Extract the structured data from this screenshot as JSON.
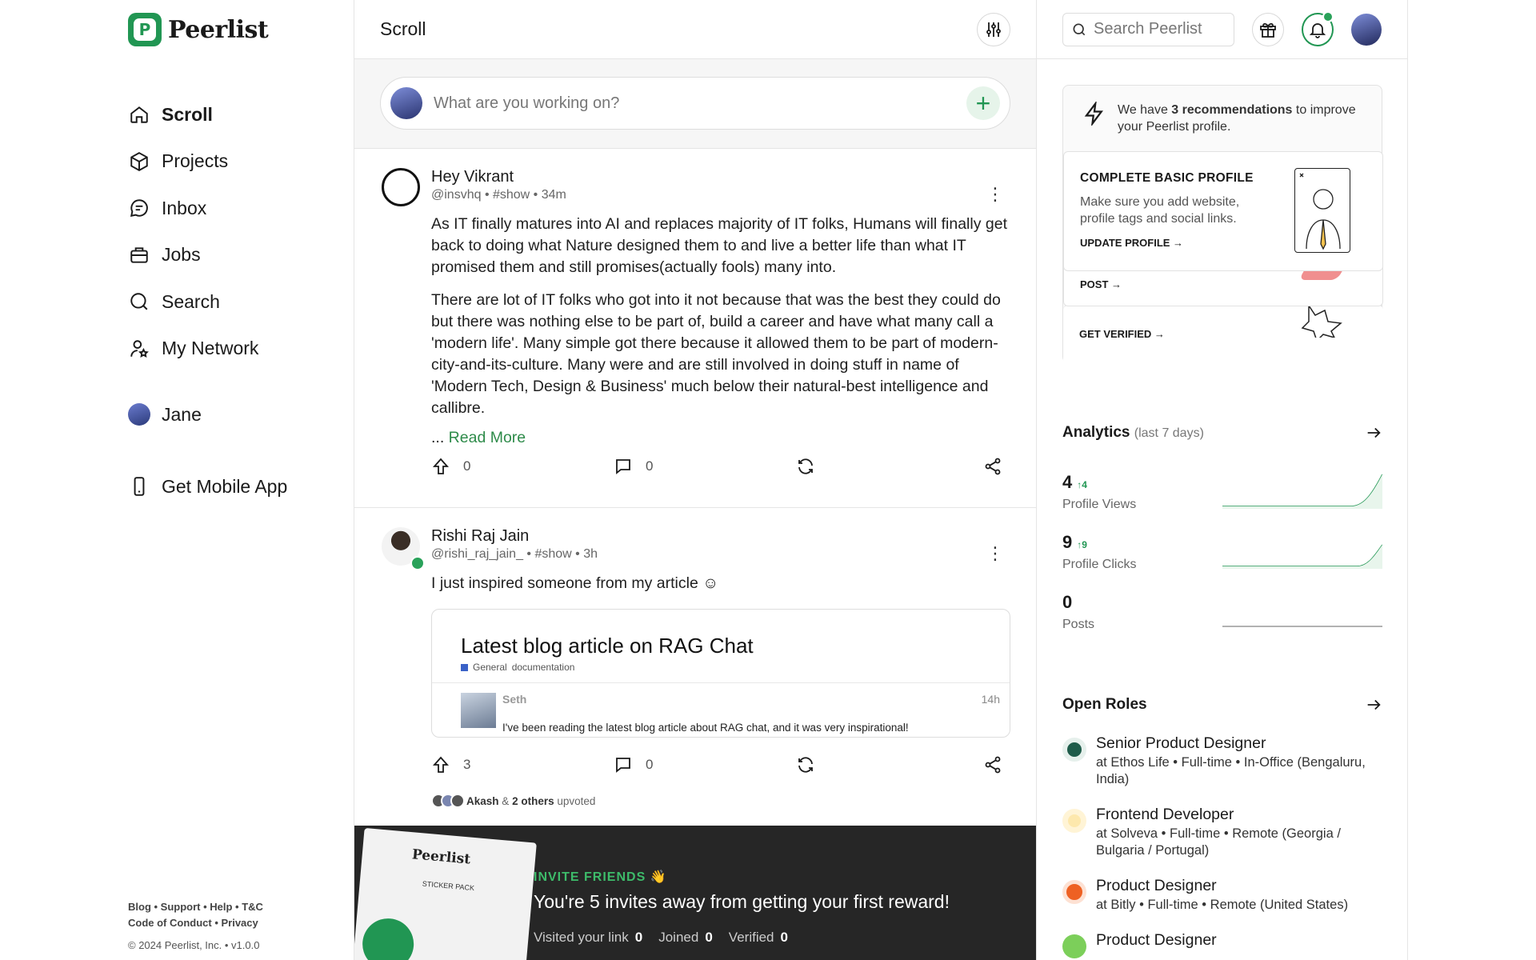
{
  "brand": {
    "name": "Peerlist",
    "mark": "P",
    "accent": "#219653"
  },
  "nav": {
    "items": [
      {
        "label": "Scroll",
        "icon": "home-icon",
        "active": true
      },
      {
        "label": "Projects",
        "icon": "cube-icon"
      },
      {
        "label": "Inbox",
        "icon": "chat-icon"
      },
      {
        "label": "Jobs",
        "icon": "briefcase-icon"
      },
      {
        "label": "Search",
        "icon": "search-icon"
      },
      {
        "label": "My Network",
        "icon": "network-icon"
      }
    ],
    "profile_name": "Jane",
    "mobile_label": "Get Mobile App"
  },
  "footer": {
    "links_line1": "Blog • Support • Help • T&C",
    "links_line2": "Code of Conduct • Privacy",
    "copyright": "© 2024 Peerlist, Inc. • v1.0.0"
  },
  "feed": {
    "title": "Scroll",
    "composer_placeholder": "What are you working on?",
    "posts": [
      {
        "author": "Hey Vikrant",
        "meta": "@insvhq • #show • 34m",
        "paragraphs": [
          "As IT finally matures into AI and replaces majority of IT folks, Humans will finally get back to doing what Nature designed them to and live a better life than what IT promised them and still promises(actually fools) many into.",
          "There are lot of IT folks who got into it not because that was the best they could do but there was nothing else to be part of, build a career and have what many call a 'modern life'. Many simple got there because it allowed them to be part of modern-city-and-its-culture. Many were and are still involved in doing stuff in name of 'Modern Tech, Design & Business' much below their natural-best intelligence and callibre."
        ],
        "read_more_prefix": "... ",
        "read_more": "Read More",
        "upvotes": "0",
        "comments": "0"
      },
      {
        "author": "Rishi Raj Jain",
        "meta": "@rishi_raj_jain_ • #show • 3h",
        "text": "I just inspired someone from my article ☺",
        "embed": {
          "title": "Latest blog article on RAG Chat",
          "tag1": "General",
          "tag2": "documentation",
          "author": "Seth",
          "time": "14h",
          "text": "I've been reading the latest blog article about RAG chat, and it was very inspirational!"
        },
        "upvotes": "3",
        "comments": "0",
        "upvoted_name": "Akash",
        "upvoted_others": "2 others",
        "upvoted_amp": "&",
        "upvoted_suffix": "upvoted"
      }
    ]
  },
  "invite": {
    "label": "INVITE FRIENDS 👋",
    "title": "You're 5 invites away from getting your first reward!",
    "visited_label": "Visited your link",
    "visited": "0",
    "joined_label": "Joined",
    "joined": "0",
    "verified_label": "Verified",
    "verified": "0",
    "sticker_title": "Peerlist",
    "sticker_sub": "STICKER PACK"
  },
  "right": {
    "search_placeholder": "Search Peerlist",
    "reco": {
      "prefix": "We have ",
      "bold": "3 recommendations",
      "suffix": " to improve your Peerlist profile.",
      "card_title": "COMPLETE BASIC PROFILE",
      "card_desc": "Make sure you add website, profile tags and social links.",
      "card_link": "UPDATE PROFILE →",
      "post_link": "POST →",
      "verify_link": "GET VERIFIED →"
    },
    "analytics": {
      "title": "Analytics",
      "subtitle": "(last 7 days)",
      "stats": [
        {
          "value": "4",
          "delta": "↑4",
          "label": "Profile Views"
        },
        {
          "value": "9",
          "delta": "↑9",
          "label": "Profile Clicks"
        },
        {
          "value": "0",
          "delta": "",
          "label": "Posts"
        }
      ]
    },
    "roles": {
      "title": "Open Roles",
      "items": [
        {
          "title": "Senior Product Designer",
          "sub": "at Ethos Life • Full-time • In-Office (Bengaluru, India)",
          "color": "#1f5c4a"
        },
        {
          "title": "Frontend Developer",
          "sub": "at Solveva • Full-time • Remote (Georgia / Bulgaria / Portugal)",
          "color": "#f2b431"
        },
        {
          "title": "Product Designer",
          "sub": "at Bitly • Full-time • Remote (United States)",
          "color": "#ee6123"
        },
        {
          "title": "Product Designer",
          "sub": "",
          "color": "#7ccf5a"
        }
      ]
    }
  }
}
